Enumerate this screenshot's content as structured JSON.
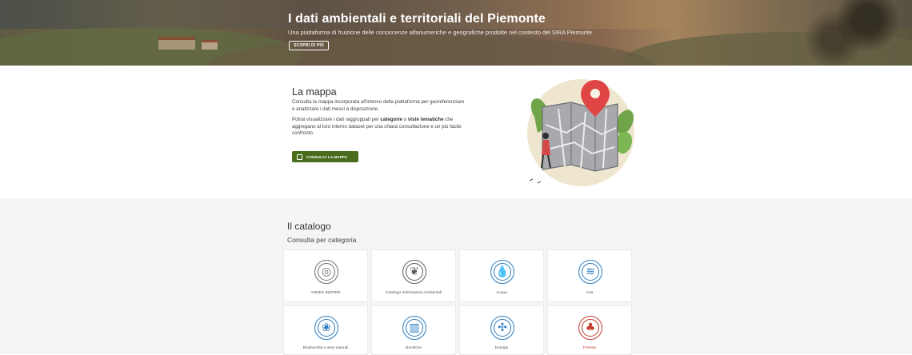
{
  "hero": {
    "title": "I dati ambientali e territoriali del Piemonte",
    "subtitle": "Una piattaforma di fruizione delle conoscenze alfanumeriche e geografiche prodotte nel contesto del SIRA Piemonte",
    "button": "SCOPRI DI PIÙ"
  },
  "map": {
    "title": "La mappa",
    "p1": "Consulta la mappa incorporata all'interno della piattaforma per georeferenziare e analizzare i dati messi a disposizione.",
    "p2_a": "Potrai visualizzare i dati raggruppati per ",
    "p2_b": "categorie",
    "p2_c": " o ",
    "p2_d": "viste tematiche",
    "p2_e": " che aggregano al loro interno dataset per una chiara consultazione e un più facile confronto.",
    "button": "CONSULTA LA MAPPA",
    "button_icon": "map-icon"
  },
  "catalog": {
    "title": "Il catalogo",
    "subtitle": "Consulta per categoria",
    "categories": [
      {
        "label": "ANNEX INSPIRE",
        "icon": "globe-fingerprint-icon",
        "color": "#6e6e6e"
      },
      {
        "label": "Catalogo Informazioni Ambientali",
        "icon": "earth-leaf-icon",
        "color": "#5a5a5a"
      },
      {
        "label": "Acqua",
        "icon": "water-drop-icon",
        "color": "#2a7bbf"
      },
      {
        "label": "Aria",
        "icon": "wind-icon",
        "color": "#2a7bbf"
      },
      {
        "label": "Biodiversità e aree naturali",
        "icon": "biodiversity-icon",
        "color": "#2a7bbf"
      },
      {
        "label": "Bonifiche",
        "icon": "factory-icon",
        "color": "#2a7bbf"
      },
      {
        "label": "Energia",
        "icon": "wind-turbine-icon",
        "color": "#2a7bbf"
      },
      {
        "label": "Foreste",
        "icon": "forest-icon",
        "color": "#c0392b"
      }
    ]
  },
  "colors": {
    "accent_green": "#4a6d1d",
    "category_blue": "#2a7bbf",
    "hover_red": "#c0392b"
  }
}
